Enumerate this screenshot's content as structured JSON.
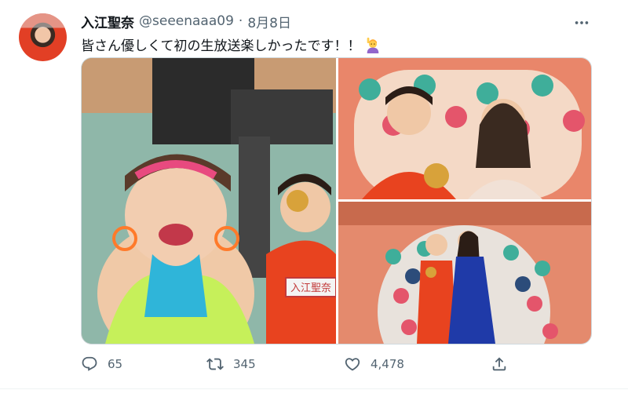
{
  "tweet": {
    "author_name": "入江聖奈",
    "handle": "@seeenaaa09",
    "separator": "·",
    "date": "8月8日",
    "text": "皆さん優しくて初の生放送楽しかったです！！",
    "emoji_icon": "person-raising-hand-emoji"
  },
  "media": {
    "count": 3,
    "images": [
      {
        "icon": "photo-selfie-studio"
      },
      {
        "icon": "photo-gold-medal-duo"
      },
      {
        "icon": "photo-studio-stage-duo"
      }
    ],
    "sign_text": "入江聖奈"
  },
  "actions": {
    "reply_count": "65",
    "retweet_count": "345",
    "like_count": "4,478"
  },
  "colors": {
    "text_primary": "#0f1419",
    "text_secondary": "#536471",
    "border": "#cfd9de"
  }
}
